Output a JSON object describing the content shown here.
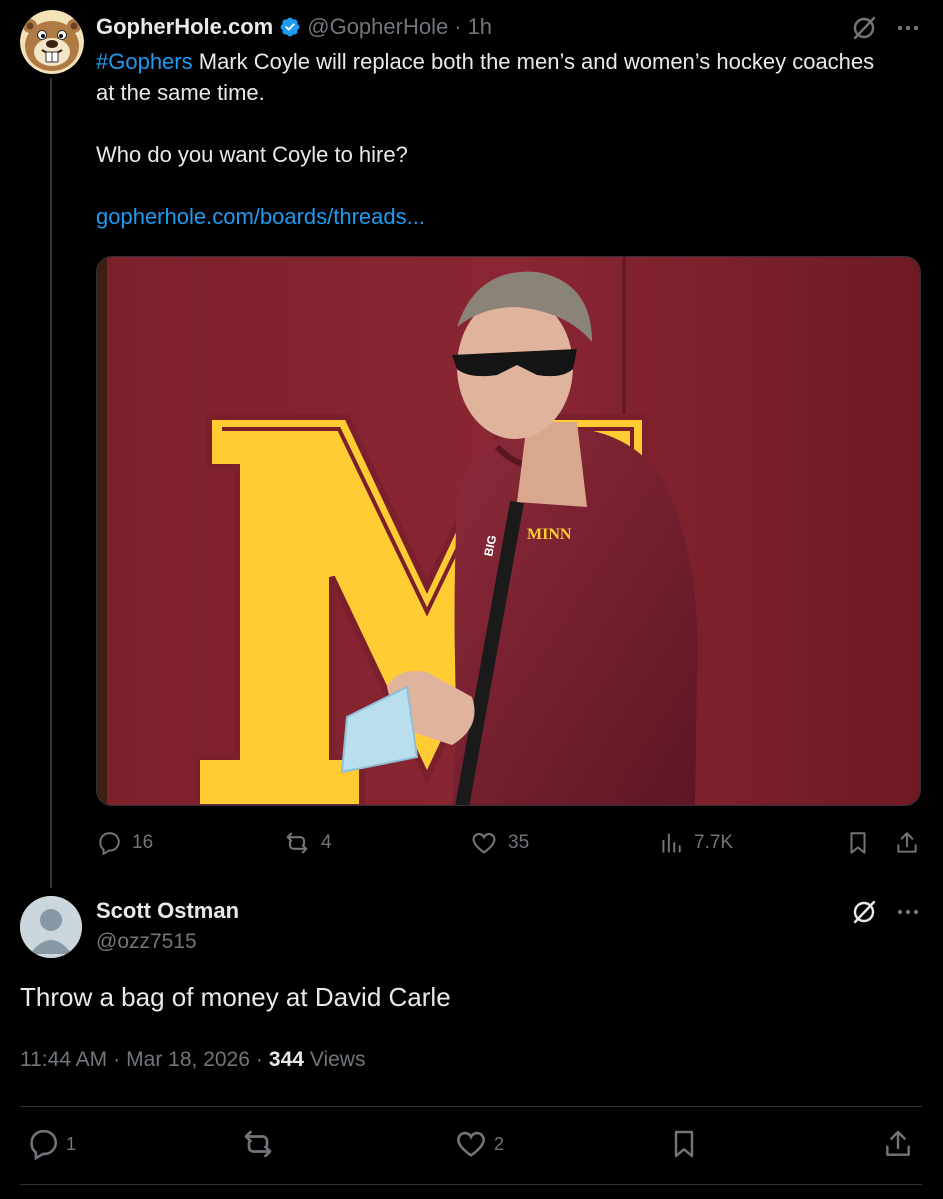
{
  "parent_tweet": {
    "display_name": "GopherHole.com",
    "handle": "@GopherHole",
    "separator": "·",
    "time": "1h",
    "hashtag": "#Gophers",
    "text_line1_rest": " Mark Coyle will replace both the men’s and women’s hockey coaches at the same time.",
    "text_paragraph2": "Who do you want Coyle to hire?",
    "link": "gopherhole.com/boards/threads...",
    "media_logo_letter": "M",
    "lanyard_text": "BIG",
    "hoodie_text": "MINN",
    "actions": {
      "replies": "16",
      "reposts": "4",
      "likes": "35",
      "views": "7.7K"
    },
    "icons": {
      "verified": "verified-badge-icon",
      "grok": "grok-icon",
      "more": "more-icon"
    }
  },
  "reply_tweet": {
    "display_name": "Scott Ostman",
    "handle": "@ozz7515",
    "text": "Throw a bag of money at David Carle",
    "time": "11:44 AM",
    "separator1": "·",
    "date": "Mar 18, 2026",
    "separator2": "·",
    "views_count": "344",
    "views_label": "Views",
    "actions": {
      "replies": "1",
      "likes": "2"
    }
  },
  "colors": {
    "background": "#000000",
    "text": "#e7e9ea",
    "secondary": "#71767b",
    "accent": "#1d9bf0",
    "divider": "#2f3336",
    "maroon": "#7a1f2b",
    "gold": "#ffcc33"
  }
}
